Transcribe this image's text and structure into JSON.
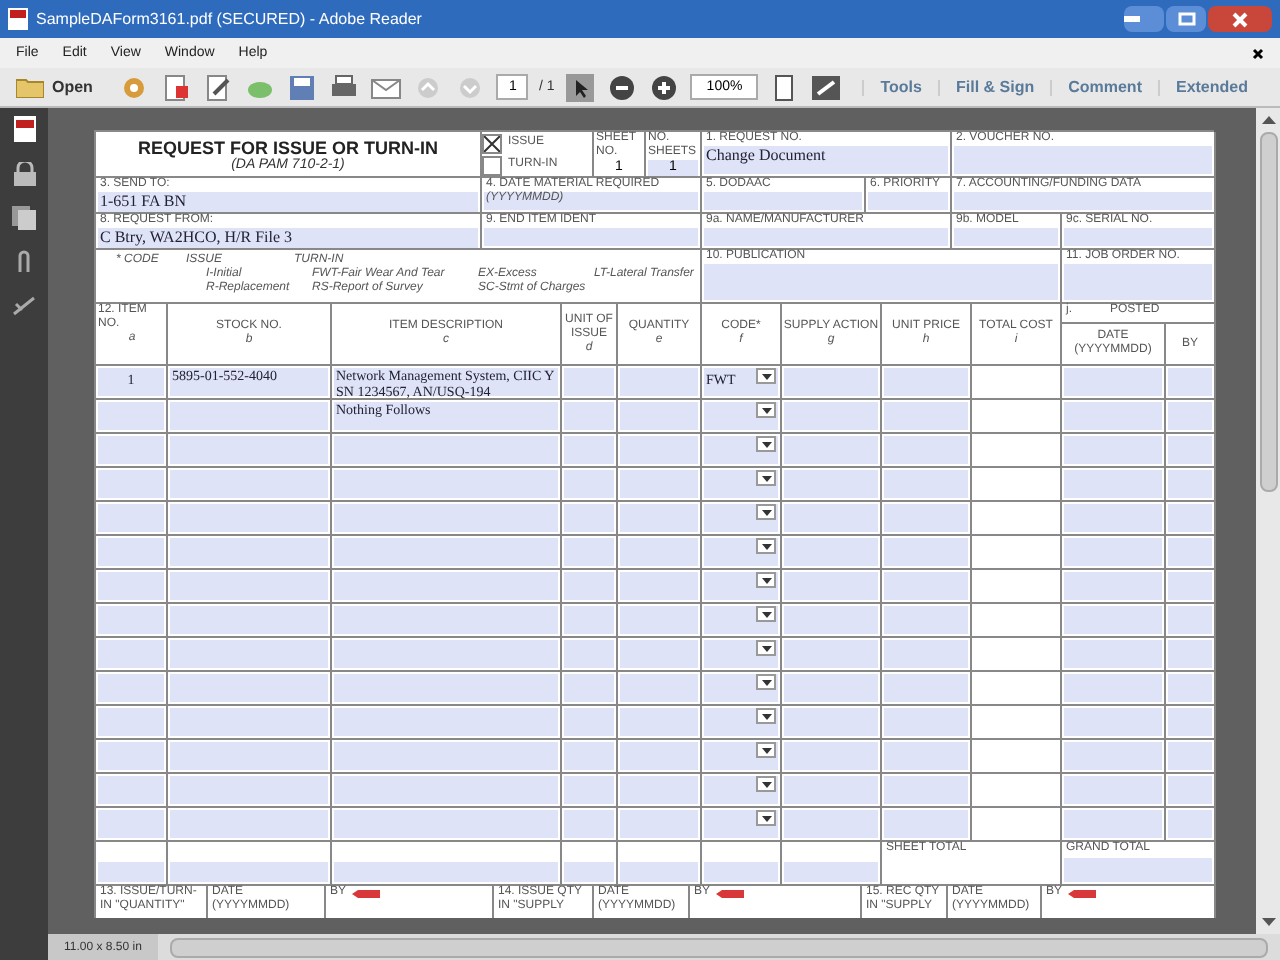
{
  "window": {
    "title": "SampleDAForm3161.pdf (SECURED) - Adobe Reader"
  },
  "menu": [
    "File",
    "Edit",
    "View",
    "Window",
    "Help"
  ],
  "toolbar": {
    "open": "Open",
    "page": "1",
    "page_count": "/ 1",
    "zoom": "100%",
    "panels": [
      "Tools",
      "Fill & Sign",
      "Comment",
      "Extended"
    ]
  },
  "form": {
    "title": "REQUEST FOR ISSUE OR TURN-IN",
    "subtitle": "(DA PAM 710-2-1)",
    "type_options": [
      {
        "label": "ISSUE",
        "selected": true
      },
      {
        "label": "TURN-IN",
        "selected": false
      }
    ],
    "sheet_no": {
      "label": "SHEET NO.",
      "value": "1"
    },
    "no_sheets": {
      "label": "NO. SHEETS",
      "value": "1"
    },
    "header_rows": [
      [
        {
          "label": "1. REQUEST NO.",
          "value": "Change Document"
        },
        {
          "label": "2. VOUCHER NO."
        }
      ],
      [
        {
          "label": "3. SEND TO:",
          "value": "1-651 FA BN"
        },
        {
          "label": "4. DATE MATERIAL REQUIRED",
          "hint": "(YYYYMMDD)"
        },
        {
          "label": "5. DODAAC"
        },
        {
          "label": "6. PRIORITY"
        },
        {
          "label": "7. ACCOUNTING/FUNDING DATA"
        }
      ],
      [
        {
          "label": "8. REQUEST FROM:",
          "value": "C Btry, WA2HCO, H/R File 3"
        },
        {
          "label": "9. END ITEM IDENT"
        },
        {
          "label": "9a. NAME/MANUFACTURER"
        },
        {
          "label": "9b. MODEL"
        },
        {
          "label": "9c. SERIAL NO."
        }
      ]
    ],
    "code_legend": {
      "title": "* CODE",
      "issue": "ISSUE",
      "turn_in": "TURN-IN",
      "rows": [
        [
          "I-Initial",
          "FWT-Fair Wear And Tear",
          "EX-Excess",
          "LT-Lateral Transfer"
        ],
        [
          "R-Replacement",
          "RS-Report of Survey",
          "SC-Stmt of Charges"
        ]
      ]
    },
    "publication": {
      "label": "10. PUBLICATION"
    },
    "job_order": {
      "label": "11. JOB ORDER NO."
    },
    "columns": [
      {
        "label": "12. ITEM NO.",
        "letter": "a"
      },
      {
        "label": "STOCK NO.",
        "letter": "b"
      },
      {
        "label": "ITEM DESCRIPTION",
        "letter": "c"
      },
      {
        "label": "UNIT OF ISSUE",
        "letter": "d"
      },
      {
        "label": "QUANTITY",
        "letter": "e"
      },
      {
        "label": "CODE*",
        "letter": "f"
      },
      {
        "label": "SUPPLY ACTION",
        "letter": "g"
      },
      {
        "label": "UNIT PRICE",
        "letter": "h"
      },
      {
        "label": "TOTAL COST",
        "letter": "i"
      }
    ],
    "posted": {
      "label": "j.",
      "title": "POSTED",
      "date": "DATE (YYYYMMDD)",
      "by": "BY"
    },
    "rows": [
      {
        "kind": "item",
        "item_no": "1",
        "stock_no": "5895-01-552-4040",
        "description": [
          "Network Management System, CIIC Y",
          "SN 1234567, AN/USQ-194"
        ],
        "code": "FWT"
      },
      {
        "kind": "item",
        "description": [
          "Nothing Follows"
        ]
      },
      {
        "kind": "blank"
      },
      {
        "kind": "blank"
      },
      {
        "kind": "blank"
      },
      {
        "kind": "blank"
      },
      {
        "kind": "blank"
      },
      {
        "kind": "blank"
      },
      {
        "kind": "blank"
      },
      {
        "kind": "blank"
      },
      {
        "kind": "blank"
      },
      {
        "kind": "blank"
      },
      {
        "kind": "blank"
      },
      {
        "kind": "blank"
      }
    ],
    "sheet_total": "SHEET TOTAL",
    "grand_total": "GRAND TOTAL",
    "footer": [
      {
        "label": "13. ISSUE/TURN-IN \"QUANTITY\""
      },
      {
        "label": "DATE (YYYYMMDD)"
      },
      {
        "label": "BY",
        "sign": true
      },
      {
        "label": "14. ISSUE QTY IN \"SUPPLY"
      },
      {
        "label": "DATE (YYYYMMDD)"
      },
      {
        "label": "BY",
        "sign": true
      },
      {
        "label": "15. REC QTY IN \"SUPPLY"
      },
      {
        "label": "DATE (YYYYMMDD)"
      },
      {
        "label": "BY",
        "sign": true
      }
    ]
  },
  "status_bar": {
    "page_size": "11.00 x 8.50 in"
  }
}
